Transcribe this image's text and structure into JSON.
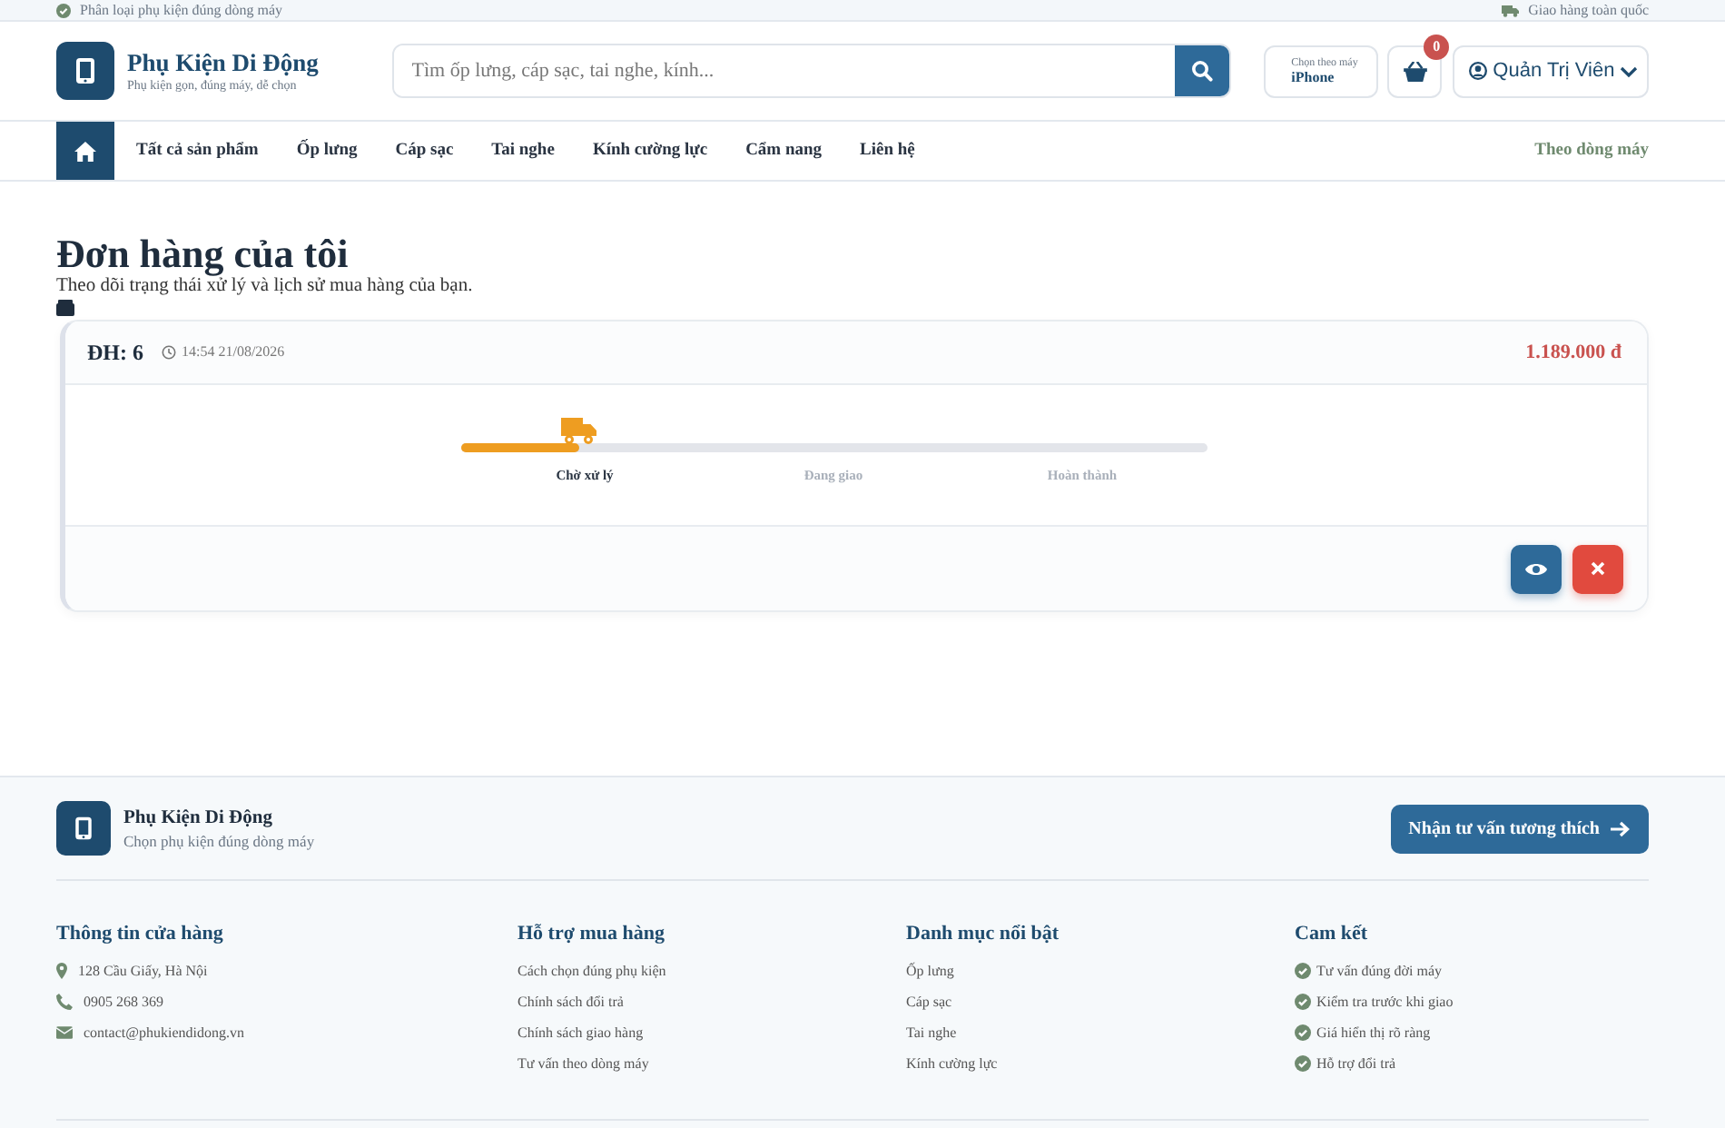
{
  "top_bar": {
    "left": "Phân loại phụ kiện đúng dòng máy",
    "right": "Giao hàng toàn quốc"
  },
  "header": {
    "brand": "Phụ Kiện Di Động",
    "tagline": "Phụ kiện gọn, đúng máy, dễ chọn",
    "search": {
      "placeholder": "Tìm ốp lưng, cáp sạc, tai nghe, kính..."
    },
    "device_picker": {
      "label": "Chọn theo máy",
      "value": "iPhone"
    },
    "cart_count": "0",
    "user": "Quản Trị Viên"
  },
  "nav": {
    "items": [
      {
        "label": "Tất cả sản phẩm",
        "selected": false
      },
      {
        "label": "Ốp lưng",
        "selected": false
      },
      {
        "label": "Cáp sạc",
        "selected": false
      },
      {
        "label": "Tai nghe",
        "selected": false
      },
      {
        "label": "Kính cường lực",
        "selected": false
      },
      {
        "label": "Cẩm nang",
        "selected": false
      },
      {
        "label": "Liên hệ",
        "selected": false
      }
    ],
    "right": "Theo dòng máy"
  },
  "page": {
    "title": "Đơn hàng của tôi",
    "subtitle": "Theo dõi trạng thái xử lý và lịch sử mua hàng của bạn."
  },
  "orders": [
    {
      "id": "ĐH: 6",
      "time": "14:54 21/08/2026",
      "total": "1.189.000 đ",
      "level": 0.16,
      "steps": [
        {
          "label": "Chờ xử lý",
          "current": true
        },
        {
          "label": "Đang giao",
          "current": false
        },
        {
          "label": "Hoàn thành",
          "current": false
        }
      ]
    }
  ],
  "footer": {
    "brand": "Phụ Kiện Di Động",
    "tagline": "Chọn phụ kiện đúng dòng máy",
    "cta": "Nhận tư vấn tương thích",
    "columns": [
      {
        "title": "Thông tin cửa hàng",
        "kind": "contact",
        "items": [
          {
            "kind": "address",
            "text": "128 Cầu Giấy, Hà Nội"
          },
          {
            "kind": "phone",
            "text": "0905 268 369"
          },
          {
            "kind": "email",
            "text": "contact@phukiendidong.vn"
          }
        ]
      },
      {
        "title": "Hỗ trợ mua hàng",
        "kind": "links",
        "items": [
          {
            "text": "Cách chọn đúng phụ kiện"
          },
          {
            "text": "Chính sách đổi trả"
          },
          {
            "text": "Chính sách giao hàng"
          },
          {
            "text": "Tư vấn theo dòng máy"
          }
        ]
      },
      {
        "title": "Danh mục nổi bật",
        "kind": "links",
        "items": [
          {
            "text": "Ốp lưng"
          },
          {
            "text": "Cáp sạc"
          },
          {
            "text": "Tai nghe"
          },
          {
            "text": "Kính cường lực"
          }
        ]
      },
      {
        "title": "Cam kết",
        "kind": "checks",
        "items": [
          {
            "text": "Tư vấn đúng đời máy"
          },
          {
            "text": "Kiểm tra trước khi giao"
          },
          {
            "text": "Giá hiển thị rõ ràng"
          },
          {
            "text": "Hỗ trợ đổi trả"
          }
        ]
      }
    ]
  }
}
